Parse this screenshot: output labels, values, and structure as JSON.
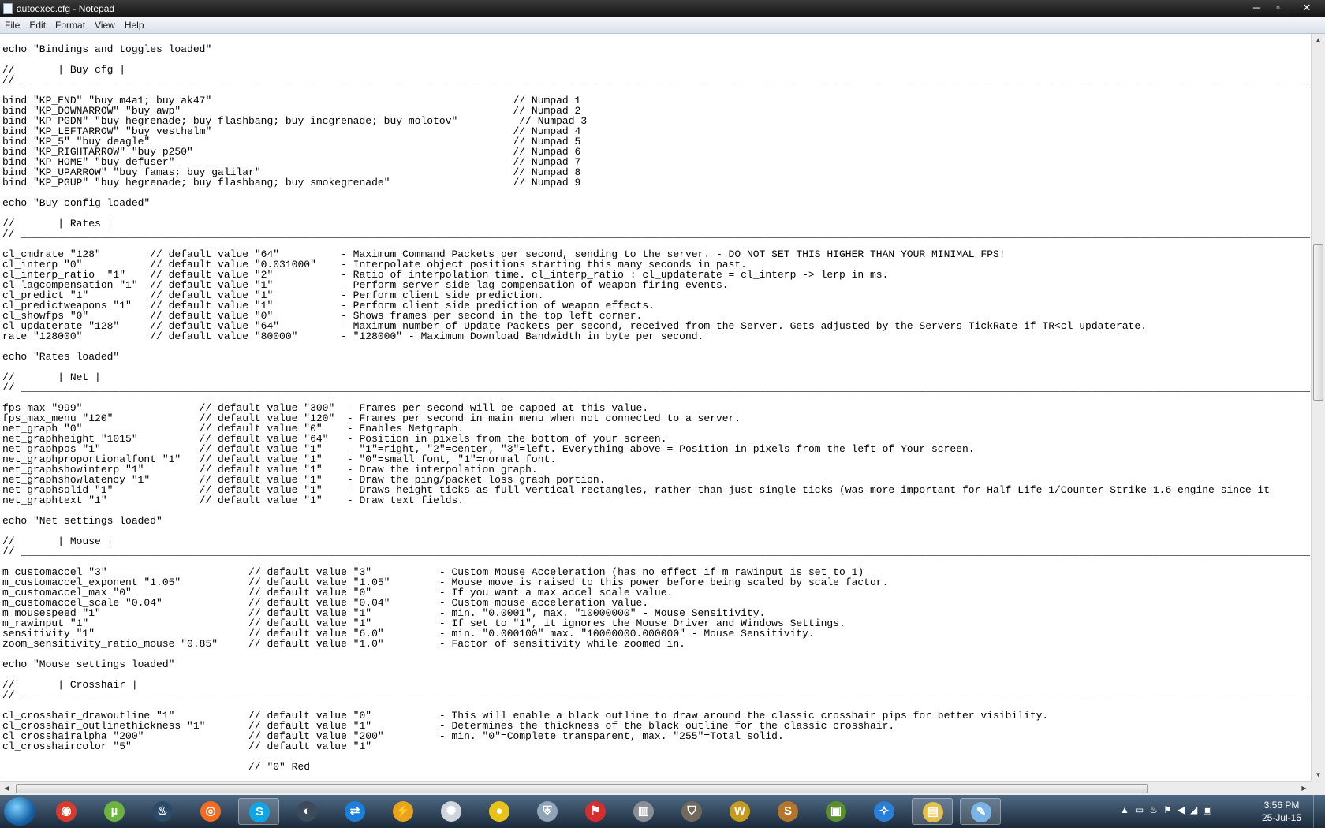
{
  "window": {
    "title": "autoexec.cfg - Notepad"
  },
  "controls": {
    "minimize": "─",
    "restore": "▫",
    "close": "✕"
  },
  "menu": [
    "File",
    "Edit",
    "Format",
    "View",
    "Help"
  ],
  "lines": [
    "echo \"Bindings and toggles loaded\"",
    "",
    "//       | Buy cfg |",
    "// ____________________________________________________________________________________________________________________________________________________________________________________________________________________________",
    "",
    "bind \"KP_END\" \"buy m4a1; buy ak47\"                                                 // Numpad 1",
    "bind \"KP_DOWNARROW\" \"buy awp\"                                                      // Numpad 2",
    "bind \"KP_PGDN\" \"buy hegrenade; buy flashbang; buy incgrenade; buy molotov\"          // Numpad 3",
    "bind \"KP_LEFTARROW\" \"buy vesthelm\"                                                 // Numpad 4",
    "bind \"KP_5\" \"buy deagle\"                                                           // Numpad 5",
    "bind \"KP_RIGHTARROW\" \"buy p250\"                                                    // Numpad 6",
    "bind \"KP_HOME\" \"buy defuser\"                                                       // Numpad 7",
    "bind \"KP_UPARROW\" \"buy famas; buy galilar\"                                         // Numpad 8",
    "bind \"KP_PGUP\" \"buy hegrenade; buy flashbang; buy smokegrenade\"                    // Numpad 9",
    "",
    "echo \"Buy config loaded\"",
    "",
    "//       | Rates |",
    "// ____________________________________________________________________________________________________________________________________________________________________________________________________________________________",
    "",
    "cl_cmdrate \"128\"        // default value \"64\"          - Maximum Command Packets per second, sending to the server. - DO NOT SET THIS HIGHER THAN YOUR MINIMAL FPS!",
    "cl_interp \"0\"           // default value \"0.031000\"    - Interpolate object positions starting this many seconds in past.",
    "cl_interp_ratio  \"1\"    // default value \"2\"           - Ratio of interpolation time. cl_interp_ratio : cl_updaterate = cl_interp -> lerp in ms.",
    "cl_lagcompensation \"1\"  // default value \"1\"           - Perform server side lag compensation of weapon firing events.",
    "cl_predict \"1\"          // default value \"1\"           - Perform client side prediction.",
    "cl_predictweapons \"1\"   // default value \"1\"           - Perform client side prediction of weapon effects.",
    "cl_showfps \"0\"          // default value \"0\"           - Shows frames per second in the top left corner.",
    "cl_updaterate \"128\"     // default value \"64\"          - Maximum number of Update Packets per second, received from the Server. Gets adjusted by the Servers TickRate if TR<cl_updaterate.",
    "rate \"128000\"           // default value \"80000\"       - \"128000\" - Maximum Download Bandwidth in byte per second.",
    "",
    "echo \"Rates loaded\"",
    "",
    "//       | Net |",
    "// ____________________________________________________________________________________________________________________________________________________________________________________________________________________________",
    "",
    "fps_max \"999\"                   // default value \"300\"  - Frames per second will be capped at this value.",
    "fps_max_menu \"120\"              // default value \"120\"  - Frames per second in main menu when not connected to a server.",
    "net_graph \"0\"                   // default value \"0\"    - Enables Netgraph.",
    "net_graphheight \"1015\"          // default value \"64\"   - Position in pixels from the bottom of your screen.",
    "net_graphpos \"1\"                // default value \"1\"    - \"1\"=right, \"2\"=center, \"3\"=left. Everything above = Position in pixels from the left of Your screen.",
    "net_graphproportionalfont \"1\"   // default value \"1\"    - \"0\"=small font, \"1\"=normal font.",
    "net_graphshowinterp \"1\"         // default value \"1\"    - Draw the interpolation graph.",
    "net_graphshowlatency \"1\"        // default value \"1\"    - Draw the ping/packet loss graph portion.",
    "net_graphsolid \"1\"              // default value \"1\"    - Draws height ticks as full vertical rectangles, rather than just single ticks (was more important for Half-Life 1/Counter-Strike 1.6 engine since it",
    "net_graphtext \"1\"               // default value \"1\"    - Draw text fields.",
    "",
    "echo \"Net settings loaded\"",
    "",
    "//       | Mouse |",
    "// ____________________________________________________________________________________________________________________________________________________________________________________________________________________________",
    "",
    "m_customaccel \"3\"                       // default value \"3\"           - Custom Mouse Acceleration (has no effect if m_rawinput is set to 1)",
    "m_customaccel_exponent \"1.05\"           // default value \"1.05\"        - Mouse move is raised to this power before being scaled by scale factor.",
    "m_customaccel_max \"0\"                   // default value \"0\"           - If you want a max accel scale value.",
    "m_customaccel_scale \"0.04\"              // default value \"0.04\"        - Custom mouse acceleration value.",
    "m_mousespeed \"1\"                        // default value \"1\"           - min. \"0.0001\", max. \"10000000\" - Mouse Sensitivity.",
    "m_rawinput \"1\"                          // default value \"1\"           - If set to \"1\", it ignores the Mouse Driver and Windows Settings.",
    "sensitivity \"1\"                         // default value \"6.0\"         - min. \"0.000100\" max. \"10000000.000000\" - Mouse Sensitivity.",
    "zoom_sensitivity_ratio_mouse \"0.85\"     // default value \"1.0\"         - Factor of sensitivity while zoomed in.",
    "",
    "echo \"Mouse settings loaded\"",
    "",
    "//       | Crosshair |",
    "// ____________________________________________________________________________________________________________________________________________________________________________________________________________________________",
    "",
    "cl_crosshair_drawoutline \"1\"            // default value \"0\"           - This will enable a black outline to draw around the classic crosshair pips for better visibility.",
    "cl_crosshair_outlinethickness \"1\"       // default value \"1\"           - Determines the thickness of the black outline for the classic crosshair.",
    "cl_crosshairalpha \"200\"                 // default value \"200\"         - min. \"0\"=Complete transparent, max. \"255\"=Total solid.",
    "cl_crosshaircolor \"5\"                   // default value \"1\"",
    "",
    "                                        // \"0\" Red"
  ],
  "scroll": {
    "vertical_position": 0.35,
    "horizontal_position": 0.0
  },
  "taskbar": {
    "apps": [
      {
        "name": "chrome-icon",
        "glyph": "◉",
        "color": "#d93a2b"
      },
      {
        "name": "utorrent-icon",
        "glyph": "µ",
        "color": "#6db33f"
      },
      {
        "name": "steam-icon",
        "glyph": "♨",
        "color": "#2a4a68"
      },
      {
        "name": "origin-icon",
        "glyph": "◎",
        "color": "#f36c21"
      },
      {
        "name": "skype-icon",
        "glyph": "S",
        "color": "#12a5e6",
        "active": true
      },
      {
        "name": "alienware-icon",
        "glyph": "◐",
        "color": "#3c4a5c"
      },
      {
        "name": "teamviewer-icon",
        "glyph": "⇄",
        "color": "#1b7fd9"
      },
      {
        "name": "thunderbolt-tool-icon",
        "glyph": "⚡",
        "color": "#e8a21c"
      },
      {
        "name": "steelseries-icon",
        "glyph": "✺",
        "color": "#cfd5dc"
      },
      {
        "name": "disc-icon",
        "glyph": "●",
        "color": "#e7c21a"
      },
      {
        "name": "shield-app-icon",
        "glyph": "⛨",
        "color": "#8fa3b9"
      },
      {
        "name": "flash-app-icon",
        "glyph": "⚑",
        "color": "#d32f2f"
      },
      {
        "name": "server-app-icon",
        "glyph": "▥",
        "color": "#8a8f96"
      },
      {
        "name": "world-of-tanks-icon",
        "glyph": "⛉",
        "color": "#6f6a5b"
      },
      {
        "name": "warcraft-icon",
        "glyph": "W",
        "color": "#c69a1e"
      },
      {
        "name": "game-s-icon",
        "glyph": "S",
        "color": "#b5752a"
      },
      {
        "name": "minecraft-icon",
        "glyph": "▣",
        "color": "#5a8f2e"
      },
      {
        "name": "battle-net-icon",
        "glyph": "✧",
        "color": "#2a7ed6"
      },
      {
        "name": "explorer-icon",
        "glyph": "▤",
        "color": "#e5c14a",
        "active": true
      },
      {
        "name": "notepad-icon",
        "glyph": "✎",
        "color": "#7ab4e6",
        "active": true
      }
    ],
    "tray_icons": [
      "▲",
      "▭",
      "♨",
      "⚑",
      "◀",
      "◢",
      "▣"
    ],
    "time": "3:56 PM",
    "date": "25-Jul-15"
  }
}
